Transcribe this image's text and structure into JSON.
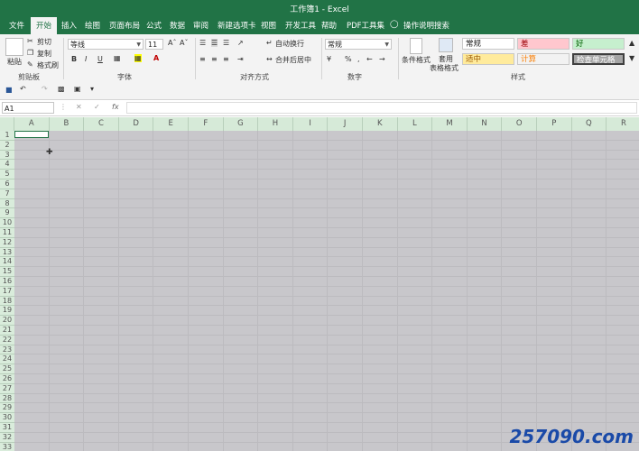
{
  "window": {
    "title": "工作簿1 - Excel"
  },
  "tabs": [
    "文件",
    "开始",
    "插入",
    "绘图",
    "页面布局",
    "公式",
    "数据",
    "审阅",
    "新建选项卡",
    "视图",
    "开发工具",
    "帮助",
    "PDF工具集",
    "操作说明搜索"
  ],
  "ribbon": {
    "clipboard": {
      "paste": "粘贴",
      "cut": "剪切",
      "copy": "复制",
      "format_painter": "格式刷",
      "label": "剪贴板"
    },
    "font": {
      "name": "等线",
      "size": "11",
      "bold": "B",
      "italic": "I",
      "underline": "U",
      "label": "字体"
    },
    "alignment": {
      "wrap": "自动换行",
      "merge": "合并后居中",
      "label": "对齐方式"
    },
    "number": {
      "format": "常规",
      "percent": "%",
      "comma": ",",
      "label": "数字"
    },
    "styles": {
      "conditional": "条件格式",
      "table1": "套用",
      "table2": "表格格式",
      "cells": [
        "常规",
        "差",
        "好",
        "适中",
        "计算",
        "检查单元格"
      ],
      "colors": {
        "normal": "#ffffff",
        "bad": "#ffc7ce",
        "good": "#c6efce",
        "neutral": "#ffeb9c",
        "calc": "#f2f2f2",
        "check": "#a5a5a5"
      },
      "label": "样式"
    }
  },
  "formula_bar": {
    "name_box": "A1",
    "fx": "fx",
    "value": ""
  },
  "columns": [
    "A",
    "B",
    "C",
    "D",
    "E",
    "F",
    "G",
    "H",
    "I",
    "J",
    "K",
    "L",
    "M",
    "N",
    "O",
    "P",
    "Q",
    "R"
  ],
  "rows": [
    "1",
    "2",
    "3",
    "4",
    "5",
    "6",
    "7",
    "8",
    "9",
    "10",
    "11",
    "12",
    "13",
    "14",
    "15",
    "16",
    "17",
    "18",
    "19",
    "20",
    "21",
    "22",
    "23",
    "24",
    "25",
    "26",
    "27",
    "28",
    "29",
    "30",
    "31",
    "32",
    "33"
  ],
  "watermark": "257090.com"
}
